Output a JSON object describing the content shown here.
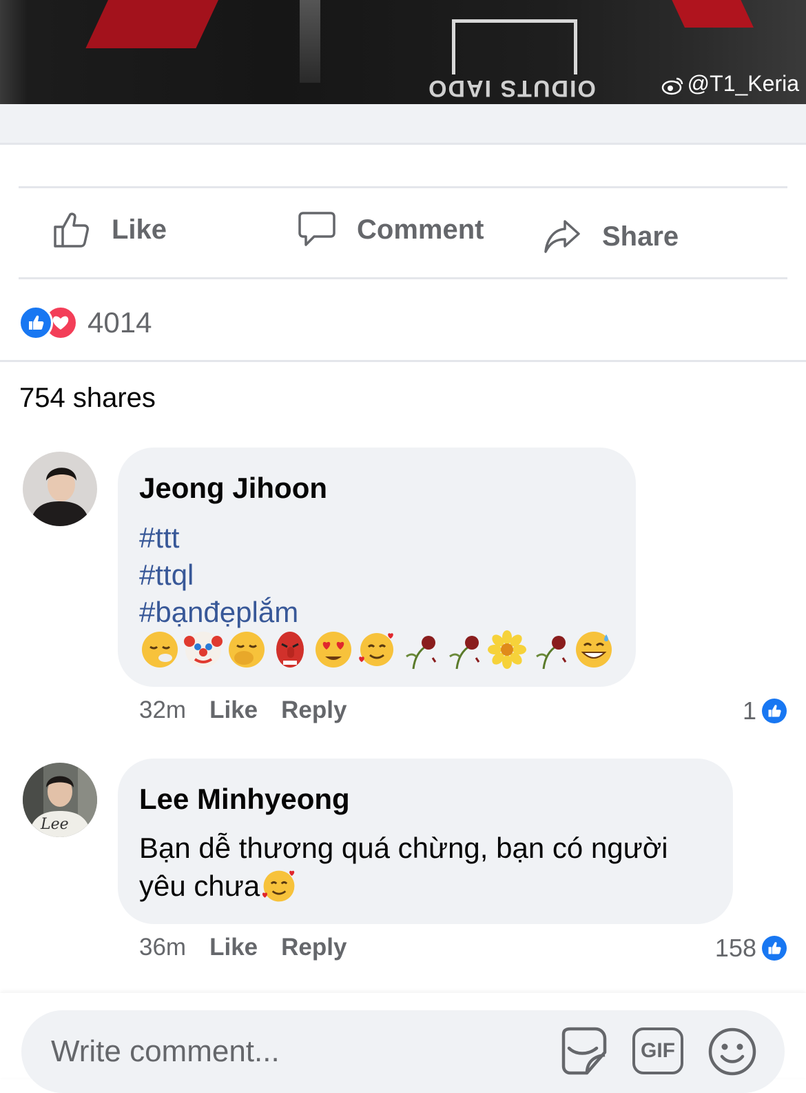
{
  "photo": {
    "patch_text": "OIDUTS IADO",
    "watermark": "@T1_Keria"
  },
  "actions": {
    "like_label": "Like",
    "comment_label": "Comment",
    "share_label": "Share"
  },
  "reactions": {
    "count": "4014"
  },
  "shares_text": "754 shares",
  "comments": [
    {
      "author": "Jeong Jihoon",
      "hashtags": [
        "#ttt",
        "#ttql",
        "#bạnđẹplắm"
      ],
      "emojis": [
        "exhausted-face",
        "clown-face",
        "yawning-face",
        "goblin-mask",
        "heart-eyes-face",
        "smiling-face-with-hearts",
        "wilted-flower",
        "wilted-flower",
        "blossom",
        "wilted-flower",
        "grinning-sweat-face"
      ],
      "time": "32m",
      "like_label": "Like",
      "reply_label": "Reply",
      "likes": "1"
    },
    {
      "author": "Lee Minhyeong",
      "text_line1": "Bạn dễ thương quá chừng, bạn có người",
      "text_line2": "yêu chưa",
      "time": "36m",
      "like_label": "Like",
      "reply_label": "Reply",
      "likes": "158"
    }
  ],
  "composer": {
    "placeholder": "Write comment...",
    "gif_label": "GIF"
  },
  "colors": {
    "brand_blue": "#1877f2",
    "love_red": "#f33e58",
    "hashtag_blue": "#385898",
    "muted_text": "#65676b",
    "bubble_bg": "#f0f2f5"
  }
}
